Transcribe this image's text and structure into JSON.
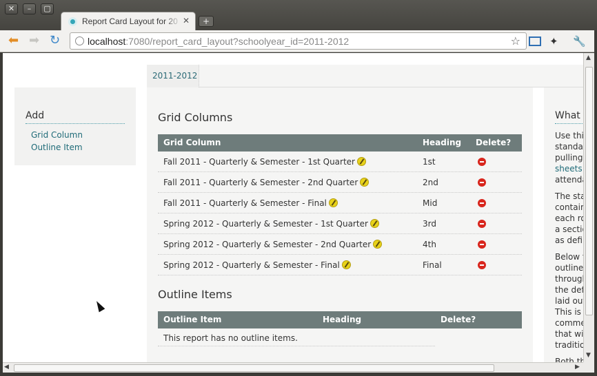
{
  "window": {
    "close_glyph": "✕",
    "min_glyph": "–",
    "max_glyph": "▢"
  },
  "tab": {
    "title": "Report Card Layout for 20",
    "close_glyph": "✕",
    "new_tab_glyph": "+"
  },
  "toolbar": {
    "back_glyph": "⬅",
    "forward_glyph": "➡",
    "reload_glyph": "↻",
    "url_host": "localhost",
    "url_rest": ":7080/report_card_layout?schoolyear_id=2011-2012",
    "star_glyph": "☆",
    "pin_glyph": "✦",
    "wrench_glyph": "🔧"
  },
  "page": {
    "year_tab": "2011-2012",
    "sidebar": {
      "heading": "Add",
      "links": [
        "Grid Column",
        "Outline Item"
      ]
    },
    "grid_section": {
      "title": "Grid Columns",
      "headers": [
        "Grid Column",
        "Heading",
        "Delete?"
      ],
      "rows": [
        {
          "name": "Fall 2011 - Quarterly & Semester - 1st Quarter",
          "heading": "1st"
        },
        {
          "name": "Fall 2011 - Quarterly & Semester - 2nd Quarter",
          "heading": "2nd"
        },
        {
          "name": "Fall 2011 - Quarterly & Semester - Final",
          "heading": "Mid"
        },
        {
          "name": "Spring 2012 - Quarterly & Semester - 1st Quarter",
          "heading": "3rd"
        },
        {
          "name": "Spring 2012 - Quarterly & Semester - 2nd Quarter",
          "heading": "4th"
        },
        {
          "name": "Spring 2012 - Quarterly & Semester - Final",
          "heading": "Final"
        }
      ]
    },
    "outline_section": {
      "title": "Outline Items",
      "headers": [
        "Outline Item",
        "Heading",
        "Delete?"
      ],
      "empty_text": "This report has no outline items."
    },
    "help": {
      "title": "What i",
      "para1": [
        "Use this",
        "standar",
        "pulling"
      ],
      "para1_link": "sheets",
      "para1_end": "attenda",
      "para2": [
        "The sta",
        "contain",
        "each ro",
        "a sectio",
        "as defin"
      ],
      "para3": [
        "Below t",
        "outline",
        "through",
        "the def",
        "laid out",
        "This is n",
        "comme",
        "that wil",
        "traditio"
      ],
      "para4": "Both th"
    }
  },
  "colors": {
    "table_header": "#6e7c7b",
    "link": "#1f6b78",
    "delete": "#d8261d",
    "edit": "#e8d21a"
  }
}
